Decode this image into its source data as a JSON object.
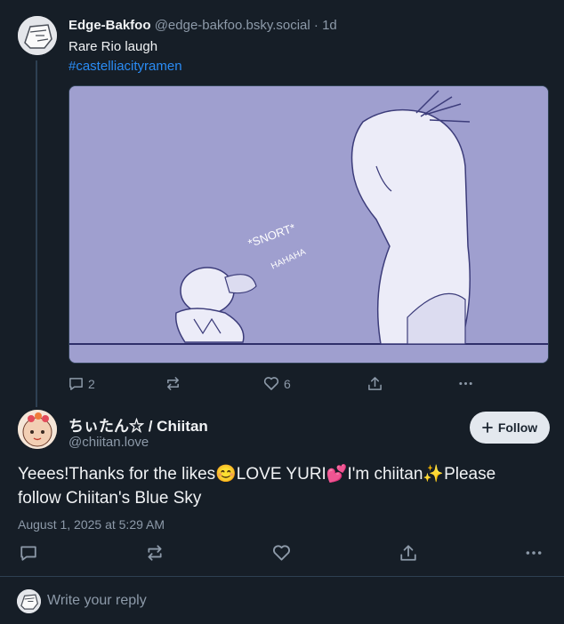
{
  "post": {
    "author_name": "Edge-Bakfoo",
    "author_handle": "@edge-bakfoo.bsky.social",
    "time": "1d",
    "text": "Rare Rio laugh",
    "hashtag": "#castelliacityramen",
    "image_text": {
      "snort": "*SNORT*",
      "haha": "HAHAHA"
    },
    "reply_count": "2",
    "like_count": "6",
    "icons": [
      "reply-icon",
      "repost-icon",
      "like-icon",
      "share-icon",
      "more-icon"
    ]
  },
  "reply_post": {
    "author_name": "ちぃたん☆ / Chiitan",
    "author_handle": "@chiitan.love",
    "follow_label": "Follow",
    "text": "Yeees!Thanks for the likes😊LOVE YURI💕I'm chiitan✨Please follow Chiitan's Blue Sky",
    "date": "August 1, 2025 at 5:29 AM",
    "icons": [
      "reply-icon",
      "repost-icon",
      "like-icon",
      "share-icon",
      "more-icon"
    ]
  },
  "composer": {
    "placeholder": "Write your reply"
  },
  "colors": {
    "background": "#161e27",
    "accent_link": "#2a8cf5",
    "muted_text": "#8d9aa9",
    "image_bg": "#9f9fcf"
  }
}
